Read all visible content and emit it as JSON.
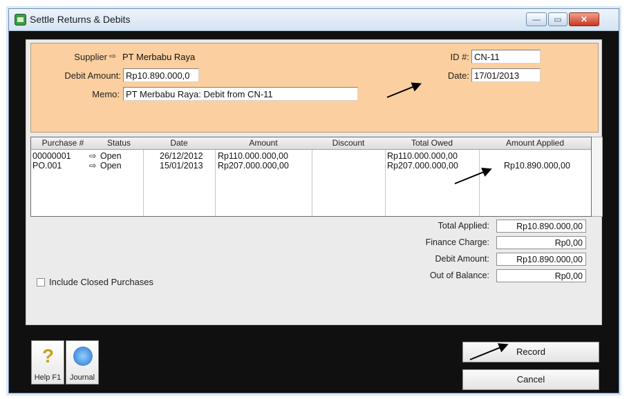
{
  "window": {
    "title": "Settle Returns & Debits",
    "close_symbol": "✕",
    "min_symbol": "—",
    "max_symbol": "▭"
  },
  "header": {
    "supplier_label": "Supplier",
    "supplier_value": "PT Merbabu Raya",
    "debit_amount_label": "Debit Amount:",
    "debit_amount_value": "Rp10.890.000,0",
    "memo_label": "Memo:",
    "memo_value": "PT Merbabu Raya: Debit from CN-11",
    "id_label": "ID #:",
    "id_value": "CN-11",
    "date_label": "Date:",
    "date_value": "17/01/2013"
  },
  "table": {
    "columns": [
      "Purchase #",
      "Status",
      "Date",
      "Amount",
      "Discount",
      "Total Owed",
      "Amount Applied"
    ],
    "rows": [
      {
        "purchase": "00000001",
        "status": "Open",
        "date": "26/12/2012",
        "amount": "Rp110.000.000,00",
        "discount": "",
        "total_owed": "Rp110.000.000,00",
        "applied": ""
      },
      {
        "purchase": "PO.001",
        "status": "Open",
        "date": "15/01/2013",
        "amount": "Rp207.000.000,00",
        "discount": "",
        "total_owed": "Rp207.000.000,00",
        "applied": "Rp10.890.000,00"
      }
    ]
  },
  "totals": {
    "total_applied_label": "Total Applied:",
    "total_applied_value": "Rp10.890.000,00",
    "finance_charge_label": "Finance Charge:",
    "finance_charge_value": "Rp0,00",
    "debit_amount_label": "Debit Amount:",
    "debit_amount_value": "Rp10.890.000,00",
    "out_of_balance_label": "Out of Balance:",
    "out_of_balance_value": "Rp0,00"
  },
  "include_closed_label": "Include Closed Purchases",
  "footer": {
    "help_label": "Help F1",
    "journal_label": "Journal",
    "record_label": "Record",
    "cancel_label": "Cancel"
  },
  "icons": {
    "zoom_arrow": "⇨"
  }
}
